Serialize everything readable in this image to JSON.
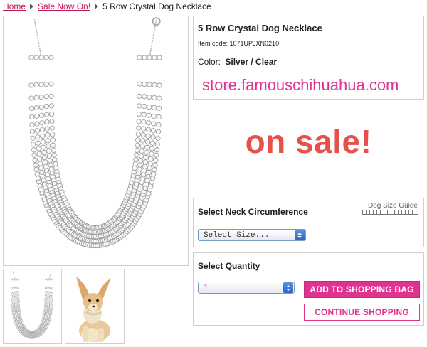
{
  "breadcrumb": {
    "home": "Home",
    "sale": "Sale Now On!",
    "current": "5 Row Crystal Dog Necklace"
  },
  "product": {
    "title": "5 Row Crystal Dog Necklace",
    "item_code": "Item code: 1071UPJXN0210",
    "color_label": "Color:",
    "color_value": "Silver / Clear"
  },
  "store_url": "store.famouschihuahua.com",
  "sale_text": "on sale!",
  "neck": {
    "heading": "Select Neck Circumference",
    "size_guide": "Dog Size Guide",
    "select_value": "Select Size..."
  },
  "quantity": {
    "heading": "Select Quantity",
    "select_value": "1"
  },
  "buttons": {
    "add": "ADD TO SHOPPING BAG",
    "continue": "CONTINUE SHOPPING"
  },
  "colors": {
    "accent": "#e0338f",
    "sale": "#e8504b",
    "link": "#c2185b"
  },
  "icons": [
    "breadcrumb-arrow-icon",
    "select-arrows-icon",
    "ruler-icon"
  ]
}
